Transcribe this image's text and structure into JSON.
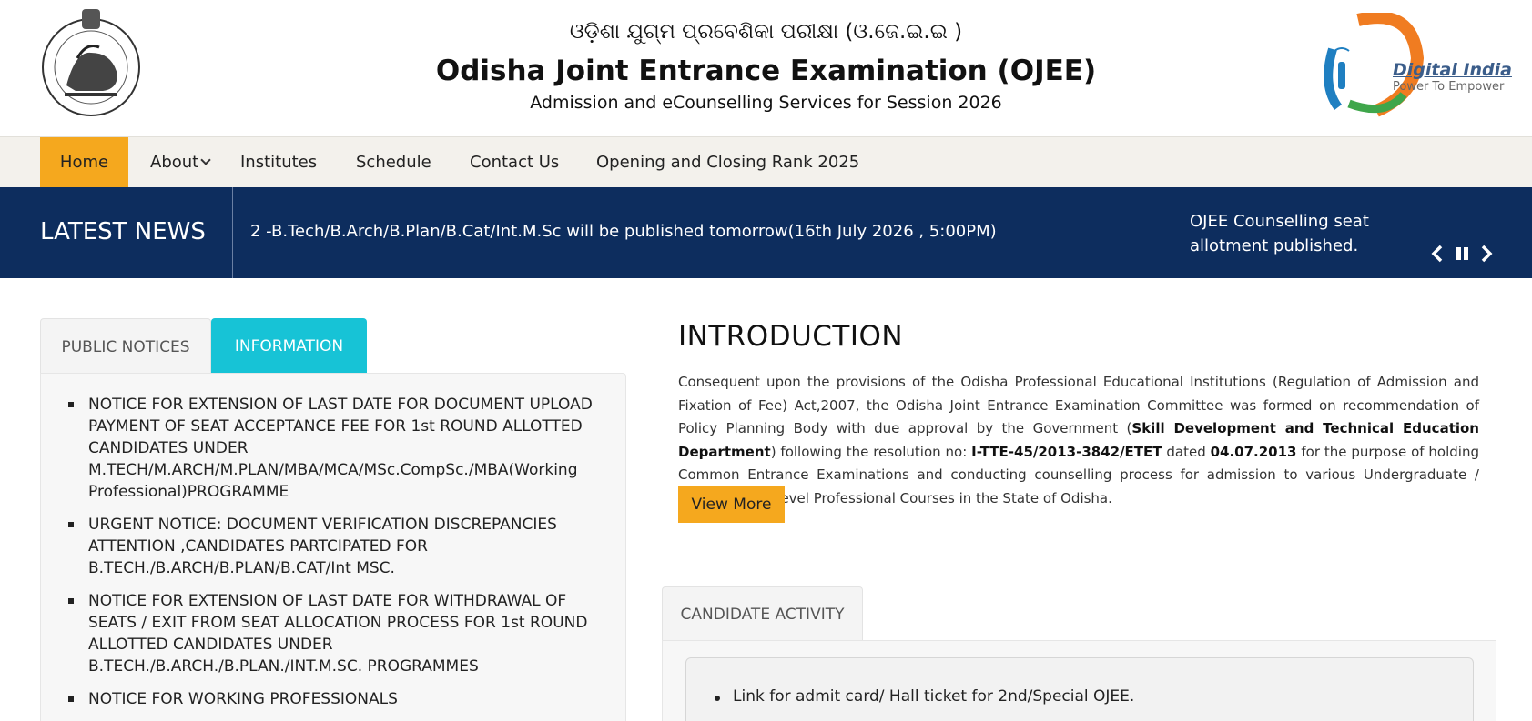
{
  "header": {
    "odia_title": "ଓଡ଼ିଶା ଯୁଗ୍ମ ପ୍ରବେଶିକା ପରୀକ୍ଷା (ଓ.ଜେ.ଇ.ଇ )",
    "title": "Odisha Joint Entrance Examination (OJEE)",
    "subtitle": "Admission and eCounselling Services for Session 2026",
    "emblem_icon": "odisha-govt-emblem-icon",
    "digital_india": {
      "name": "Digital India",
      "tagline": "Power To Empower"
    }
  },
  "nav": {
    "items": [
      {
        "label": "Home",
        "active": true
      },
      {
        "label": "About",
        "has_dropdown": true
      },
      {
        "label": "Institutes"
      },
      {
        "label": "Schedule"
      },
      {
        "label": "Contact Us"
      },
      {
        "label": "Opening and Closing Rank 2025"
      }
    ]
  },
  "news": {
    "label": "LATEST NEWS",
    "item_1": "2 -B.Tech/B.Arch/B.Plan/B.Cat/Int.M.Sc will be published tomorrow(16th July 2026 , 5:00PM)",
    "item_2": "OJEE Counselling seat allotment published.",
    "controls": [
      "chevron-left-icon",
      "pause-icon",
      "chevron-right-icon"
    ]
  },
  "left_tabs": {
    "public_notices": "PUBLIC NOTICES",
    "information": "INFORMATION",
    "notices": [
      "NOTICE FOR EXTENSION OF LAST DATE FOR DOCUMENT UPLOAD PAYMENT OF SEAT ACCEPTANCE FEE FOR 1st ROUND ALLOTTED CANDIDATES UNDER M.TECH/M.ARCH/M.PLAN/MBA/MCA/MSc.CompSc./MBA(Working Professional)PROGRAMME",
      "URGENT NOTICE: DOCUMENT VERIFICATION DISCREPANCIES ATTENTION ,CANDIDATES PARTCIPATED FOR B.TECH./B.ARCH/B.PLAN/B.CAT/Int MSC.",
      "NOTICE FOR EXTENSION OF LAST DATE FOR WITHDRAWAL OF SEATS / EXIT FROM SEAT ALLOCATION PROCESS FOR 1st ROUND ALLOTTED CANDIDATES UNDER B.TECH./B.ARCH./B.PLAN./INT.M.SC. PROGRAMMES",
      "NOTICE FOR WORKING PROFESSIONALS"
    ]
  },
  "intro": {
    "title": "INTRODUCTION",
    "p1": "Consequent upon the provisions of the Odisha Professional Educational Institutions (Regulation of Admission and Fixation of Fee) Act,2007, the Odisha Joint Entrance Examination Committee was formed on recommendation of Policy Planning Body with due approval by the Government (",
    "dept": "Skill Development and Technical Education Department",
    "p2": ") following the resolution no: ",
    "resolution": "I-TTE-45/2013-3842/ETET",
    "p3": " dated ",
    "date": "04.07.2013",
    "p4": " for the purpose of holding Common Entrance Examinations and conducting counselling process for admission to various Undergraduate / Postgraduate Level Professional Courses in the State of Odisha.",
    "view_more": "View More"
  },
  "candidate_activity": {
    "tab": "CANDIDATE ACTIVITY",
    "items": [
      "Link for admit card/ Hall ticket for 2nd/Special OJEE."
    ]
  },
  "colors": {
    "accent": "#f5a81e",
    "news_bg": "#0d2d5e",
    "info_tab": "#17c3d6",
    "nav_bg": "#f3f1ec"
  }
}
